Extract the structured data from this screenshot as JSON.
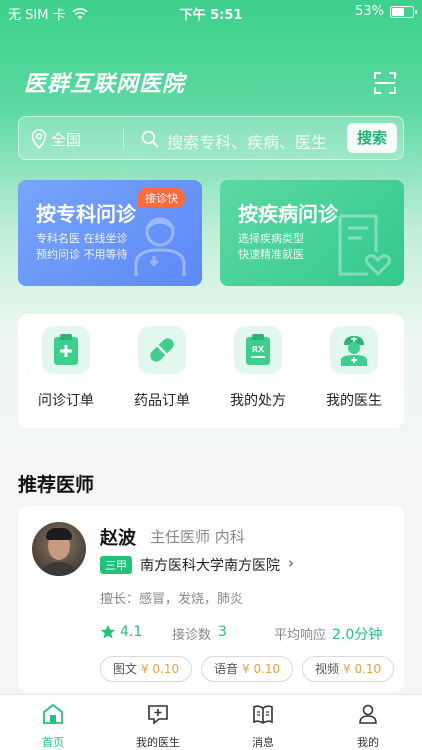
{
  "status_bar": {
    "carrier": "无 SIM 卡",
    "time": "下午 5:51",
    "battery": "53%",
    "battery_level": 0.53
  },
  "header": {
    "title": "医群互联网医院",
    "scan_icon": "scan-icon"
  },
  "search": {
    "location": "全国",
    "placeholder": "搜索专科、疾病、医生",
    "button_label": "搜索"
  },
  "cards": [
    {
      "title": "按专科问诊",
      "line1": "专科名医 在线坐诊",
      "line2": "预约问诊 不用等待",
      "badge": "接诊快",
      "color": "#6c97f8"
    },
    {
      "title": "按疾病问诊",
      "line1": "选择疾病类型",
      "line2": "快速精准就医",
      "color": "#45d195"
    }
  ],
  "quick_actions": [
    {
      "label": "问诊订单",
      "icon": "clipboard-plus-icon"
    },
    {
      "label": "药品订单",
      "icon": "pill-icon"
    },
    {
      "label": "我的处方",
      "icon": "prescription-rx-icon"
    },
    {
      "label": "我的医生",
      "icon": "doctor-icon"
    }
  ],
  "recommend": {
    "title": "推荐医师",
    "doctor": {
      "name": "赵波",
      "title": "主任医师 内科",
      "tier": "三甲",
      "hospital": "南方医科大学南方医院",
      "specialty": "擅长：感冒，发烧，肺炎",
      "rating": "4.1",
      "consult_label": "接诊数",
      "consult_count": "3",
      "response_label": "平均响应",
      "response_time": "2.0分钟",
      "prices": [
        {
          "type": "图文",
          "price": "¥ 0.10"
        },
        {
          "type": "语音",
          "price": "¥ 0.10"
        },
        {
          "type": "视频",
          "price": "¥ 0.10"
        }
      ]
    }
  },
  "tab_bar": [
    {
      "label": "首页",
      "icon": "home-icon",
      "active": true
    },
    {
      "label": "我的医生",
      "icon": "doctor-consult-icon",
      "active": false
    },
    {
      "label": "消息",
      "icon": "message-book-icon",
      "active": false
    },
    {
      "label": "我的",
      "icon": "profile-icon",
      "active": false
    }
  ],
  "colors": {
    "accent": "#22c27b",
    "badge": "#ff6a3d",
    "price": "#e4a14a"
  }
}
